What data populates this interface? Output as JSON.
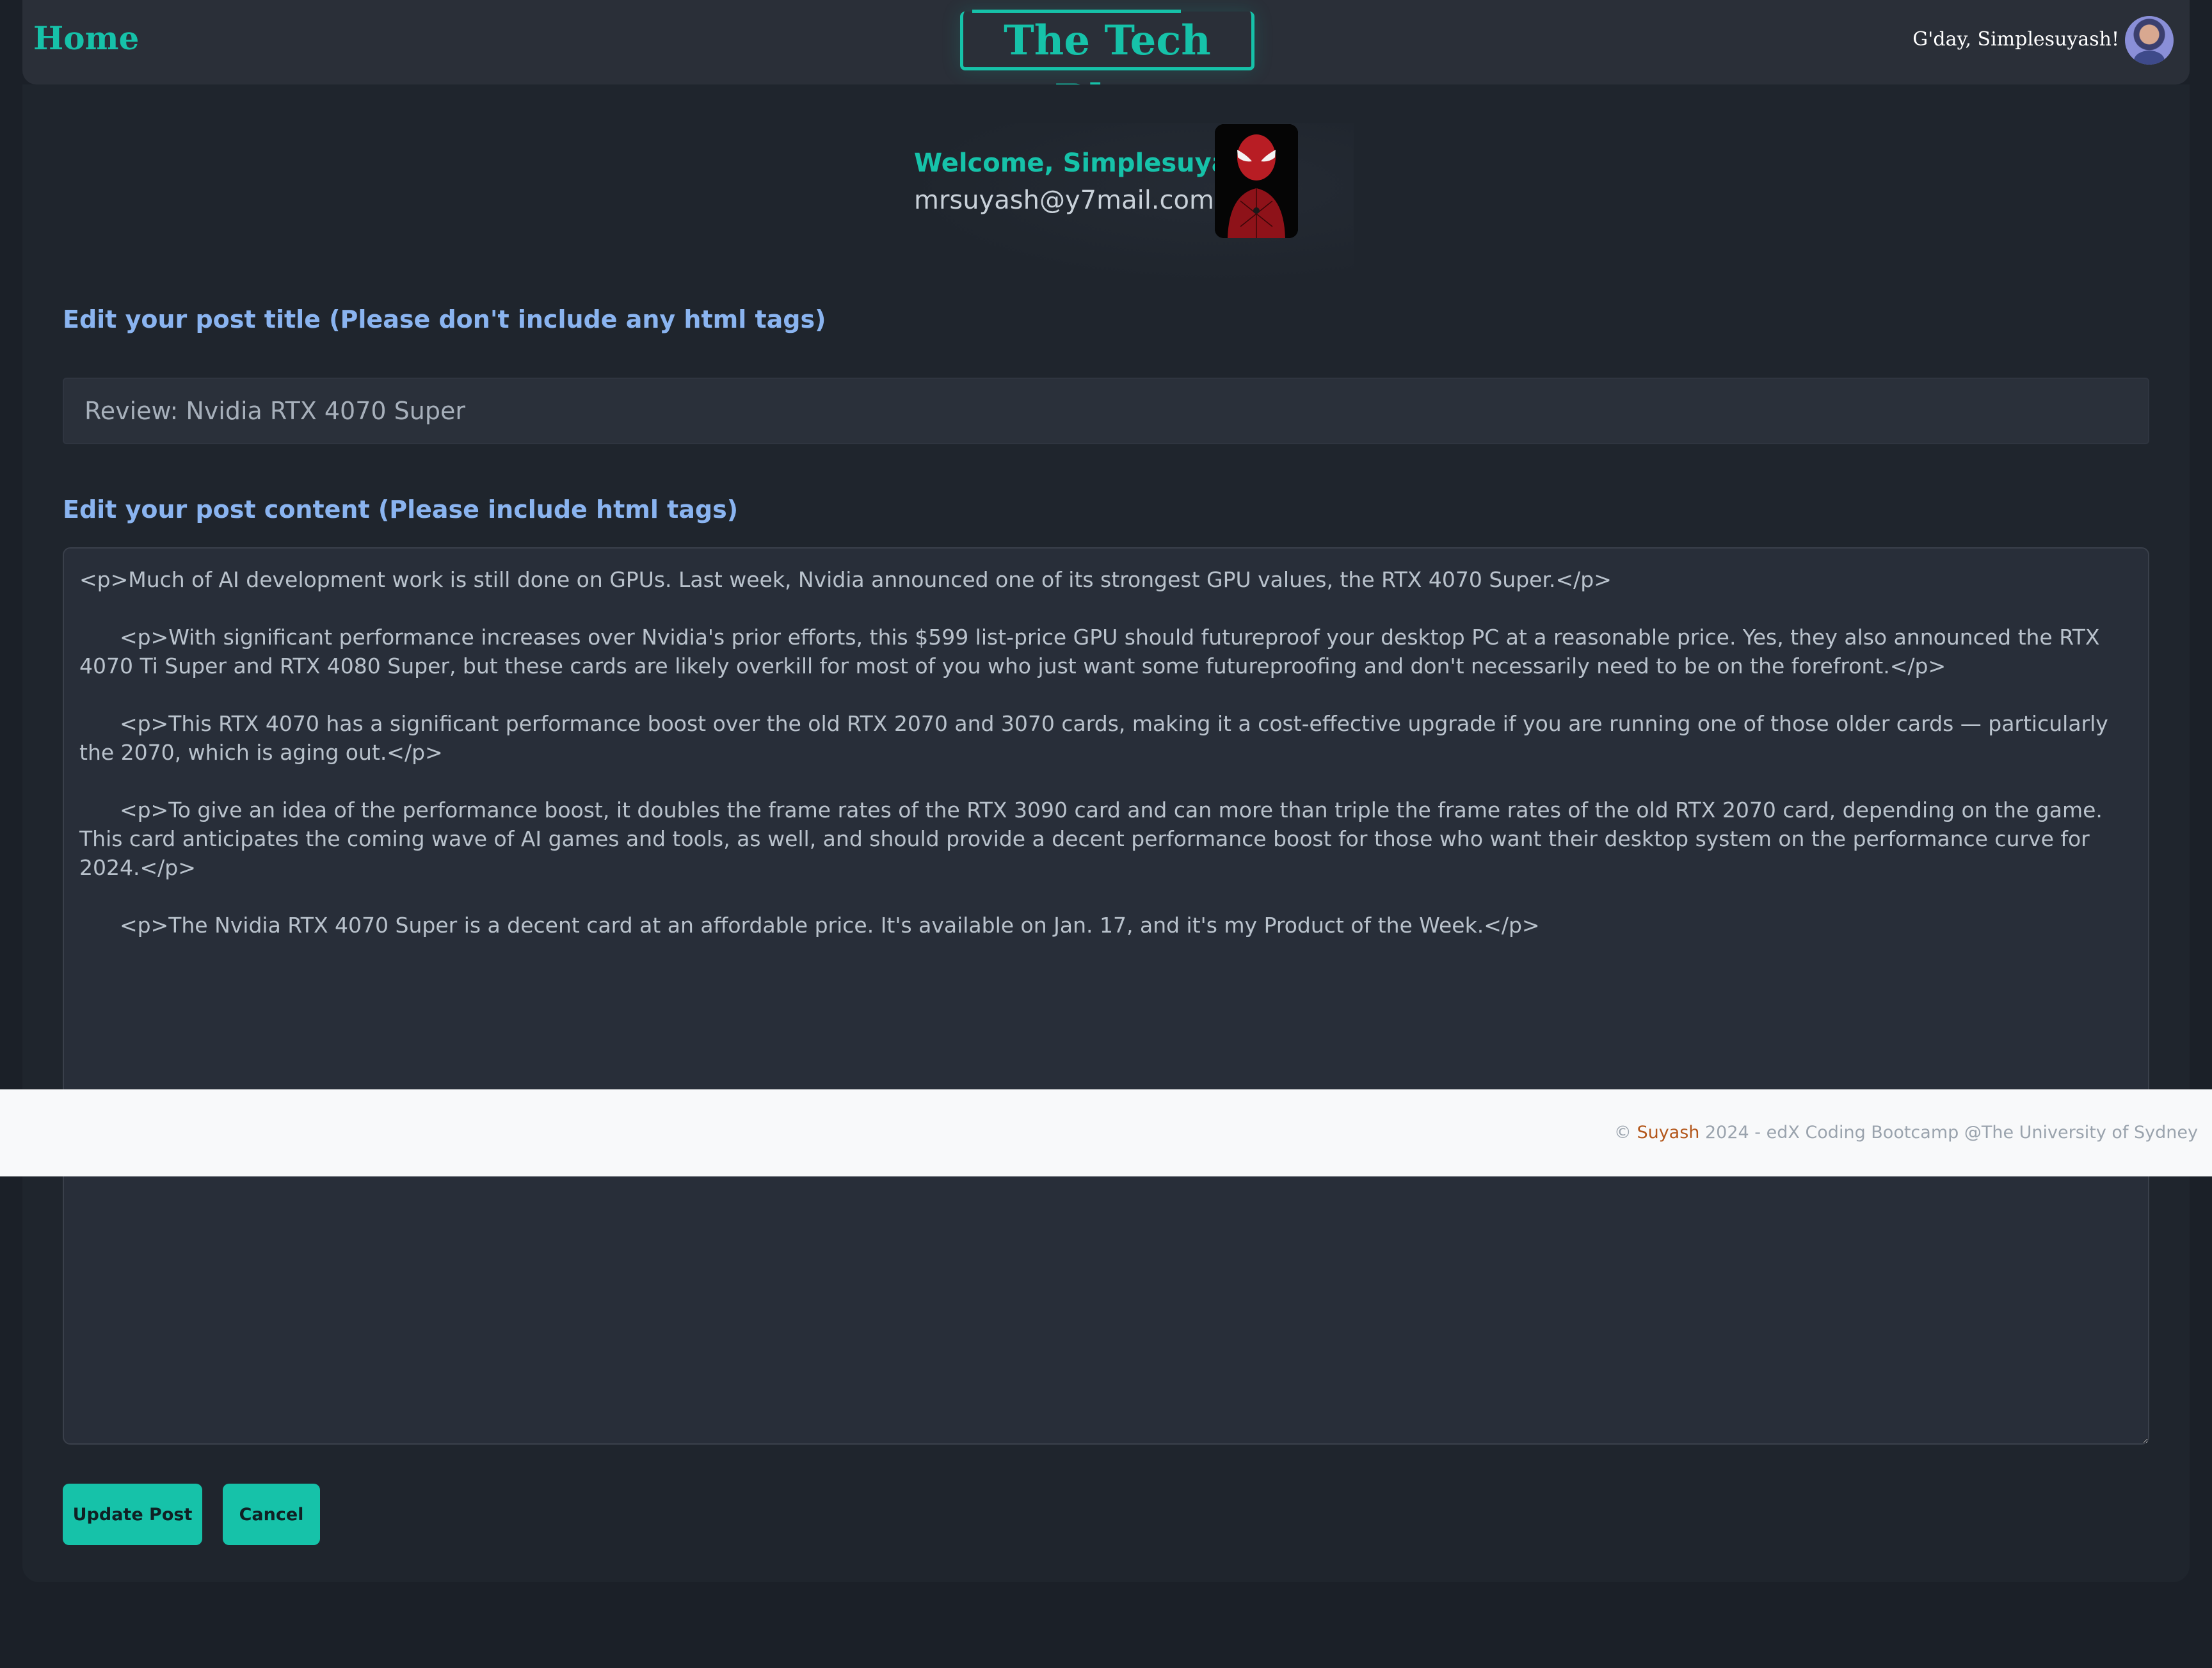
{
  "nav": {
    "home_label": "Home",
    "brand": "The Tech Blog",
    "greeting": "G'day, Simplesuyash!"
  },
  "profile": {
    "welcome": "Welcome, Simplesuyash!",
    "email": "mrsuyash@y7mail.com"
  },
  "form": {
    "title_label": "Edit your post title (Please don't include any html tags)",
    "title_value": "Review: Nvidia RTX 4070 Super",
    "content_label": "Edit your post content (Please include html tags)",
    "content_value": "<p>Much of AI development work is still done on GPUs. Last week, Nvidia announced one of its strongest GPU values, the RTX 4070 Super.</p>\n\n      <p>With significant performance increases over Nvidia's prior efforts, this $599 list-price GPU should futureproof your desktop PC at a reasonable price. Yes, they also announced the RTX 4070 Ti Super and RTX 4080 Super, but these cards are likely overkill for most of you who just want some futureproofing and don't necessarily need to be on the forefront.</p>\n\n      <p>This RTX 4070 has a significant performance boost over the old RTX 2070 and 3070 cards, making it a cost-effective upgrade if you are running one of those older cards — particularly the 2070, which is aging out.</p>\n\n      <p>To give an idea of the performance boost, it doubles the frame rates of the RTX 3090 card and can more than triple the frame rates of the old RTX 2070 card, depending on the game. This card anticipates the coming wave of AI games and tools, as well, and should provide a decent performance boost for those who want their desktop system on the performance curve for 2024.</p>\n\n      <p>The Nvidia RTX 4070 Super is a decent card at an affordable price. It's available on Jan. 17, and it's my Product of the Week.</p>",
    "update_label": "Update Post",
    "cancel_label": "Cancel"
  },
  "footer": {
    "copyright_symbol": "©",
    "author": "Suyash",
    "rest": " 2024 - edX Coding Bootcamp @The University of Sydney"
  },
  "colors": {
    "accent": "#16c2a9",
    "label_blue": "#8ab4f0",
    "background": "#1b2028",
    "footer_author": "#b3571b"
  }
}
